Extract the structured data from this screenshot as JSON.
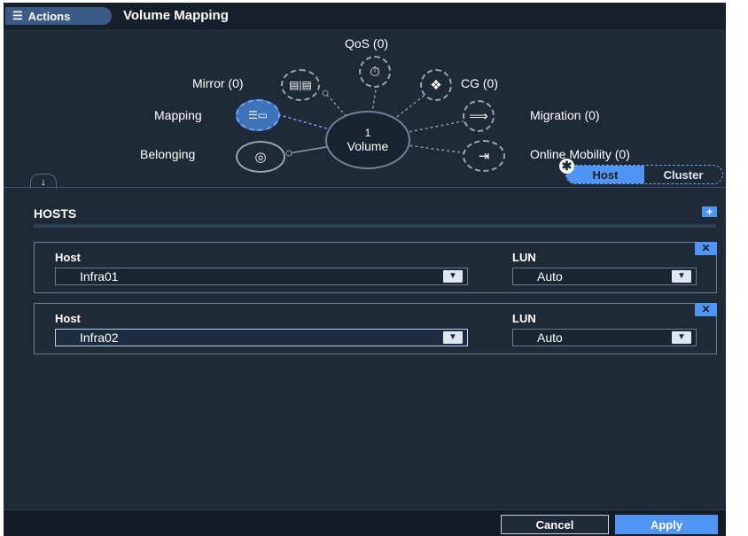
{
  "header": {
    "actions_label": "Actions",
    "title": "Volume Mapping"
  },
  "hub": {
    "qos": "QoS (0)",
    "mirror": "Mirror (0)",
    "cg": "CG (0)",
    "mapping": "Mapping",
    "migration": "Migration (0)",
    "belonging": "Belonging",
    "online_mobility": "Online Mobility (0)",
    "volume_count": "1",
    "volume_label": "Volume"
  },
  "toggle": {
    "host": "Host",
    "cluster": "Cluster"
  },
  "hosts": {
    "title": "HOSTS",
    "rows": [
      {
        "host_label": "Host",
        "host_value": "Infra01",
        "lun_label": "LUN",
        "lun_value": "Auto"
      },
      {
        "host_label": "Host",
        "host_value": "Infra02",
        "lun_label": "LUN",
        "lun_value": "Auto"
      }
    ]
  },
  "footer": {
    "cancel": "Cancel",
    "apply": "Apply"
  },
  "colors": {
    "panel_bg": "#1f2a37",
    "accent": "#4f95f5",
    "header_bg": "#16202b"
  }
}
